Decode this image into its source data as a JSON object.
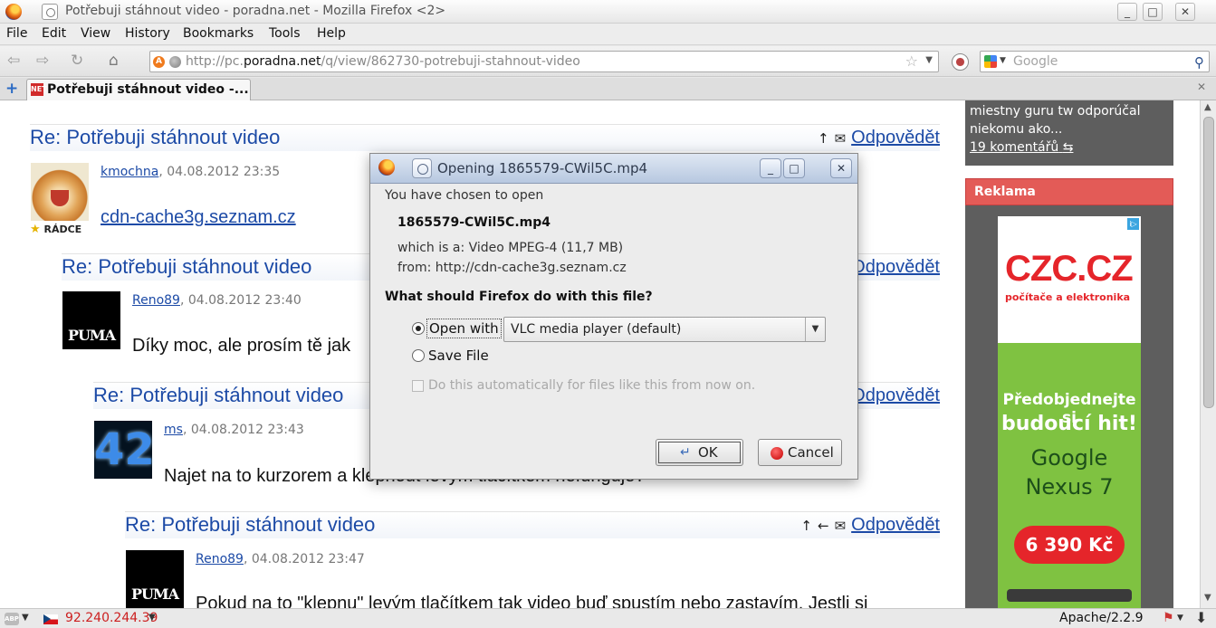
{
  "window": {
    "title": "Potřebuji stáhnout video - poradna.net - Mozilla Firefox <2>",
    "minimize": "_",
    "maximize": "□",
    "close": "✕"
  },
  "menu": [
    "File",
    "Edit",
    "View",
    "History",
    "Bookmarks",
    "Tools",
    "Help"
  ],
  "nav": {
    "url_prefix": "http://pc.",
    "url_domain": "poradna.net",
    "url_path": "/q/view/862730-potrebuji-stahnout-video",
    "search_placeholder": "Google"
  },
  "tab": {
    "title": "Potřebuji stáhnout video -...",
    "favicon": "NET"
  },
  "posts": [
    {
      "title": "Re: Potřebuji stáhnout video",
      "author": "kmochna",
      "date": ", 04.08.2012 23:35",
      "badge": "RÁDCE",
      "link": "cdn-cache3g.seznam.cz",
      "reply": "Odpovědět"
    },
    {
      "title": "Re: Potřebuji stáhnout video",
      "author": "Reno89",
      "date": ", 04.08.2012 23:40",
      "body": "Díky moc, ale prosím tě jak",
      "reply": "Odpovědět",
      "avatar_text": "PUMA"
    },
    {
      "title": "Re: Potřebuji stáhnout video",
      "author": "ms",
      "date": ", 04.08.2012 23:43",
      "body": "Najet na to kurzorem a  klepnout  levým tlačítkem nefunguje?",
      "reply": "Odpovědět",
      "avatar_text": "42"
    },
    {
      "title": "Re: Potřebuji stáhnout video",
      "author": "Reno89",
      "date": ", 04.08.2012 23:47",
      "body": "Pokud na to \"klepnu\" levým tlačítkem tak video buď spustím nebo zastavím. Jestli si",
      "reply": "Odpovědět",
      "avatar_text": "PUMA"
    }
  ],
  "sidebar": {
    "text_line1": "miestny guru tw odporúčal",
    "text_line2": "niekomu ako...",
    "comments": "19 komentářů",
    "ad_heading": "Reklama",
    "ad": {
      "logo": "CZC.CZ",
      "tagline": "počítače a elektronika",
      "line1": "Předobjednejte si",
      "line2": "budoucí hit!",
      "line3": "Google",
      "line4": "Nexus 7",
      "price": "6 390 Kč",
      "badge": "i▷"
    }
  },
  "statusbar": {
    "abp": "ABP",
    "ip": "92.240.244.39",
    "server": "Apache/2.2.9"
  },
  "dialog": {
    "title": "Opening 1865579-CWil5C.mp4",
    "chosen": "You have chosen to open",
    "filename": "1865579-CWil5C.mp4",
    "which_is": "which is a: Video MPEG-4 (11,7 MB)",
    "from": "from: http://cdn-cache3g.seznam.cz",
    "question": "What should Firefox do with this file?",
    "open_with": "Open with",
    "app": "VLC media player (default)",
    "save_file": "Save File",
    "auto": "Do this automatically for files like this from now on.",
    "ok": "OK",
    "cancel": "Cancel"
  }
}
